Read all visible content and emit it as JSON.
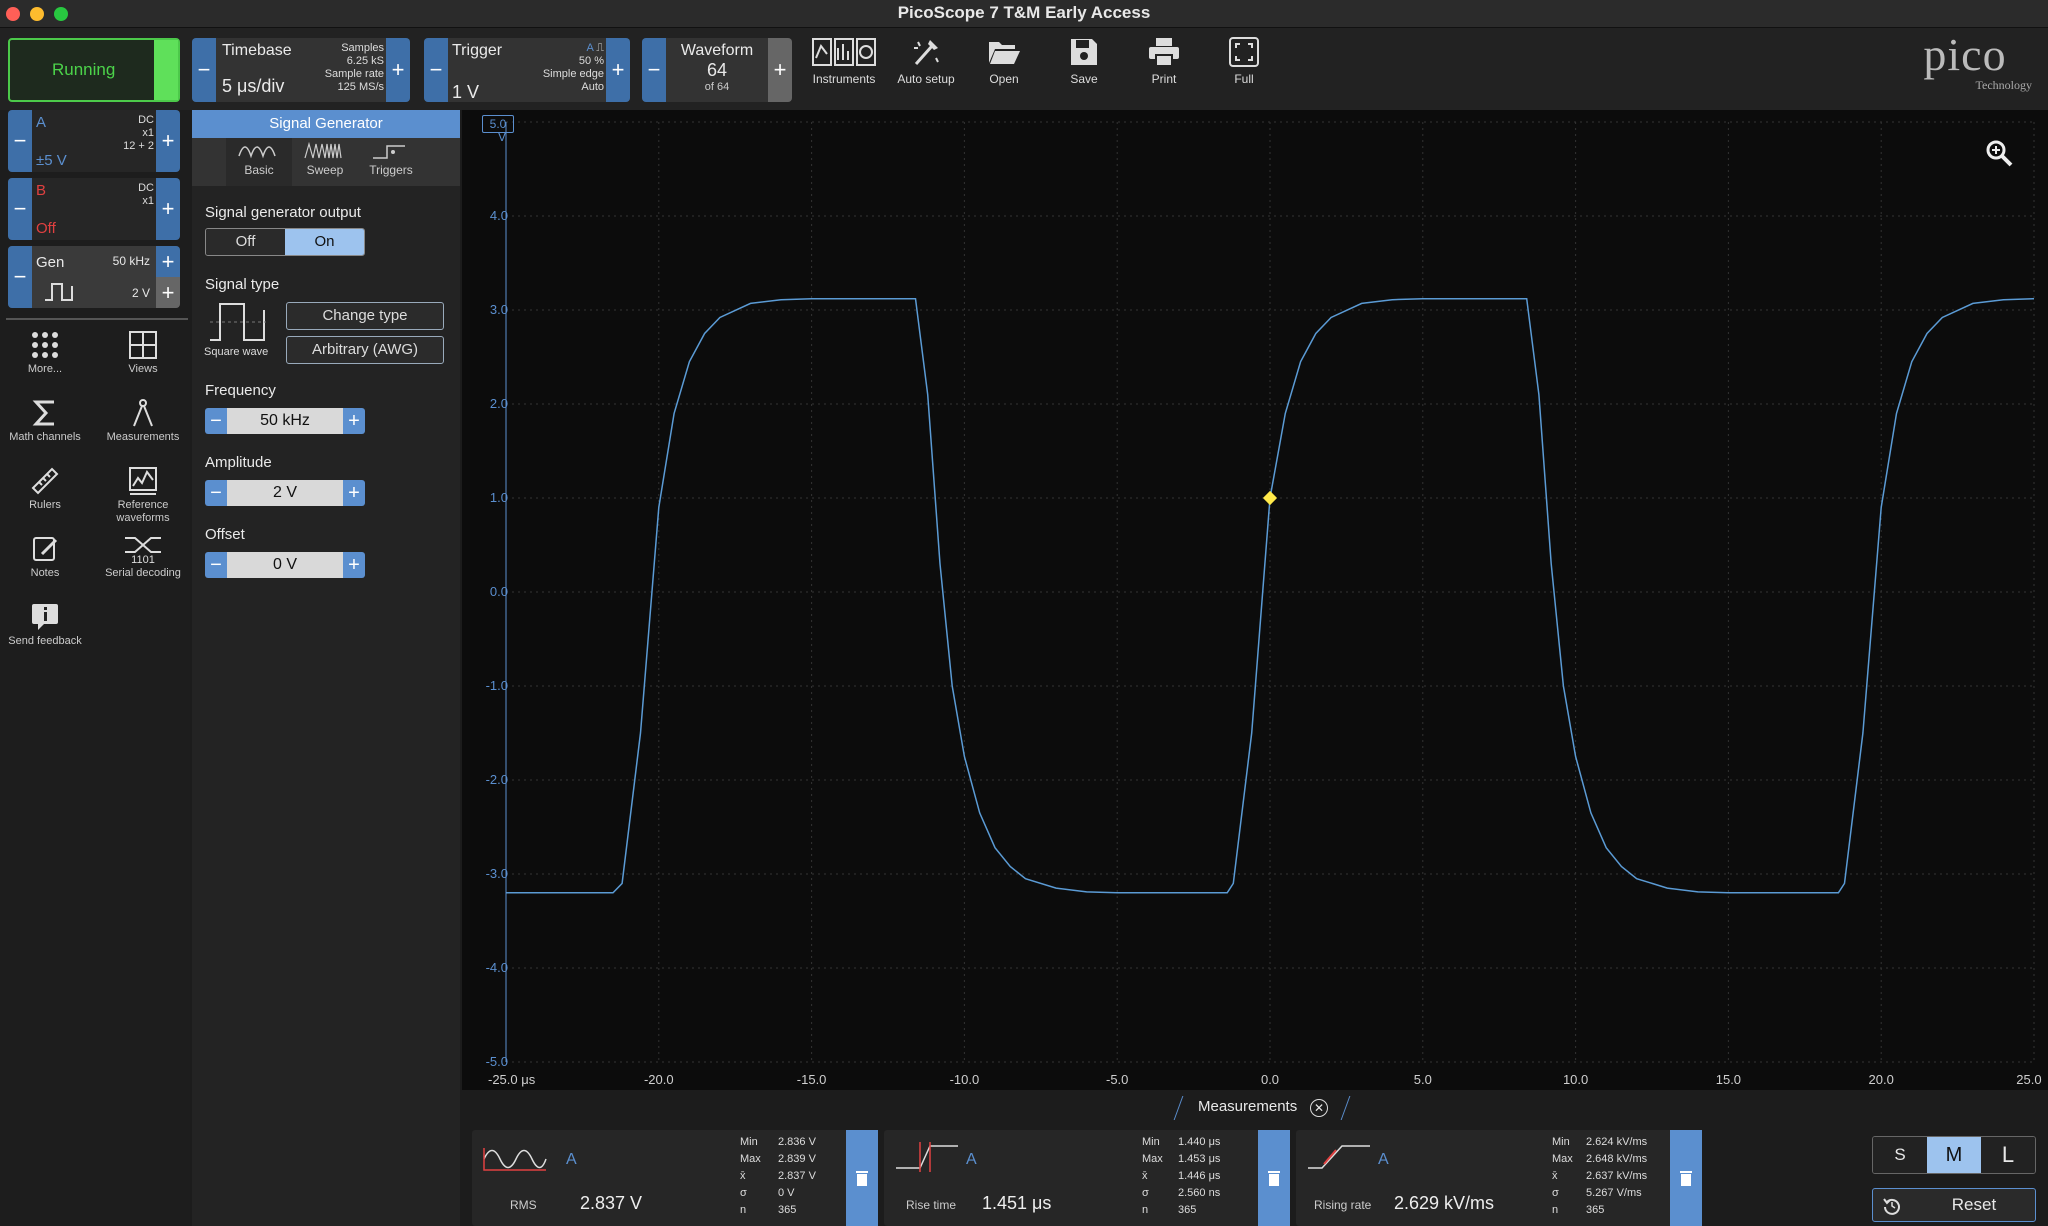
{
  "window": {
    "title": "PicoScope 7 T&M Early Access"
  },
  "run": {
    "label": "Running"
  },
  "timebase": {
    "label": "Timebase",
    "value": "5 μs/div",
    "samples_label": "Samples",
    "samples": "6.25 kS",
    "rate_label": "Sample rate",
    "rate": "125 MS/s"
  },
  "trigger": {
    "label": "Trigger",
    "level": "1 V",
    "channel": "A",
    "percent": "50 %",
    "type": "Simple edge",
    "mode": "Auto"
  },
  "waveform": {
    "label": "Waveform",
    "value": "64",
    "of": "of 64"
  },
  "tools": [
    {
      "name": "instruments",
      "label": "Instruments"
    },
    {
      "name": "auto-setup",
      "label": "Auto setup"
    },
    {
      "name": "open",
      "label": "Open"
    },
    {
      "name": "save",
      "label": "Save"
    },
    {
      "name": "print",
      "label": "Print"
    },
    {
      "name": "full",
      "label": "Full"
    }
  ],
  "logo": {
    "text": "pico",
    "sub": "Technology"
  },
  "channels": {
    "a": {
      "name": "A",
      "coupling": "DC",
      "probe": "x1",
      "bits": "12 + 2",
      "range": "±5 V"
    },
    "b": {
      "name": "B",
      "coupling": "DC",
      "probe": "x1",
      "state": "Off"
    },
    "gen": {
      "name": "Gen",
      "freq": "50 kHz",
      "amp": "2 V"
    }
  },
  "side_tools": [
    {
      "label": "More..."
    },
    {
      "label": "Views"
    },
    {
      "label": "Math channels"
    },
    {
      "label": "Measurements"
    },
    {
      "label": "Rulers"
    },
    {
      "label": "Reference waveforms"
    },
    {
      "label": "Notes"
    },
    {
      "label": "Serial decoding"
    },
    {
      "label": "Send feedback"
    }
  ],
  "siggen": {
    "header": "Signal Generator",
    "tabs": [
      "Basic",
      "Sweep",
      "Triggers"
    ],
    "output_label": "Signal generator output",
    "off": "Off",
    "on": "On",
    "type_label": "Signal type",
    "wave_name": "Square wave",
    "change_type": "Change type",
    "awg": "Arbitrary (AWG)",
    "freq_label": "Frequency",
    "freq": "50 kHz",
    "amp_label": "Amplitude",
    "amp": "2 V",
    "offset_label": "Offset",
    "offset": "0 V"
  },
  "chart_data": {
    "type": "line",
    "title": "",
    "xlabel": "μs",
    "ylabel": "V",
    "xlim": [
      -25,
      25
    ],
    "ylim": [
      -5,
      5
    ],
    "x_ticks": [
      "-25.0",
      "-20.0",
      "-15.0",
      "-10.0",
      "-5.0",
      "0.0",
      "5.0",
      "10.0",
      "15.0",
      "20.0",
      "25.0"
    ],
    "y_ticks": [
      "5.0",
      "4.0",
      "3.0",
      "2.0",
      "1.0",
      "0.0",
      "-1.0",
      "-2.0",
      "-3.0",
      "-4.0",
      "-5.0"
    ],
    "top_unit": "V",
    "grid": true,
    "trigger_point": {
      "x": 0.0,
      "y": 1.0
    },
    "series": [
      {
        "color": "#5b9bd5",
        "x": [
          -25,
          -21.5,
          -21.2,
          -20.6,
          -20,
          -19.5,
          -19,
          -18.5,
          -18,
          -17,
          -16,
          -15,
          -14,
          -13,
          -12,
          -11.6,
          -11.2,
          -10.8,
          -10.4,
          -10,
          -9.5,
          -9,
          -8.5,
          -8,
          -7,
          -6,
          -5,
          -4,
          -3,
          -2,
          -1.4,
          -1.2,
          -0.6,
          0,
          0.5,
          1,
          1.5,
          2,
          3,
          4,
          5,
          6,
          7,
          8,
          8.4,
          8.8,
          9.2,
          9.6,
          10,
          10.5,
          11,
          11.5,
          12,
          13,
          14,
          15,
          16,
          17,
          18,
          18.6,
          18.8,
          19.4,
          20,
          20.5,
          21,
          21.5,
          22,
          23,
          24,
          25
        ],
        "y": [
          -3.2,
          -3.2,
          -3.1,
          -1.5,
          0.9,
          1.9,
          2.45,
          2.75,
          2.92,
          3.07,
          3.11,
          3.12,
          3.12,
          3.12,
          3.12,
          3.12,
          2.1,
          0.3,
          -1.0,
          -1.75,
          -2.35,
          -2.72,
          -2.92,
          -3.05,
          -3.15,
          -3.19,
          -3.2,
          -3.2,
          -3.2,
          -3.2,
          -3.2,
          -3.1,
          -1.5,
          1.0,
          1.9,
          2.45,
          2.75,
          2.92,
          3.07,
          3.11,
          3.12,
          3.12,
          3.12,
          3.12,
          3.12,
          2.1,
          0.3,
          -1.0,
          -1.75,
          -2.35,
          -2.72,
          -2.92,
          -3.05,
          -3.15,
          -3.19,
          -3.2,
          -3.2,
          -3.2,
          -3.2,
          -3.2,
          -3.1,
          -1.5,
          0.9,
          1.9,
          2.45,
          2.75,
          2.92,
          3.07,
          3.11,
          3.12
        ]
      }
    ]
  },
  "measurements": {
    "header": "Measurements",
    "cards": [
      {
        "channel": "A",
        "name": "RMS",
        "value": "2.837 V",
        "min": "2.836 V",
        "max": "2.839 V",
        "mean": "2.837 V",
        "sigma": "0 V",
        "n": "365"
      },
      {
        "channel": "A",
        "name": "Rise time",
        "value": "1.451 μs",
        "min": "1.440 μs",
        "max": "1.453 μs",
        "mean": "1.446 μs",
        "sigma": "2.560 ns",
        "n": "365"
      },
      {
        "channel": "A",
        "name": "Rising rate",
        "value": "2.629 kV/ms",
        "min": "2.624 kV/ms",
        "max": "2.648 kV/ms",
        "mean": "2.637 kV/ms",
        "sigma": "5.267 V/ms",
        "n": "365"
      }
    ],
    "stat_labels": [
      "Min",
      "Max",
      "x̄",
      "σ",
      "n"
    ],
    "sizes": [
      "S",
      "M",
      "L"
    ],
    "reset": "Reset"
  }
}
